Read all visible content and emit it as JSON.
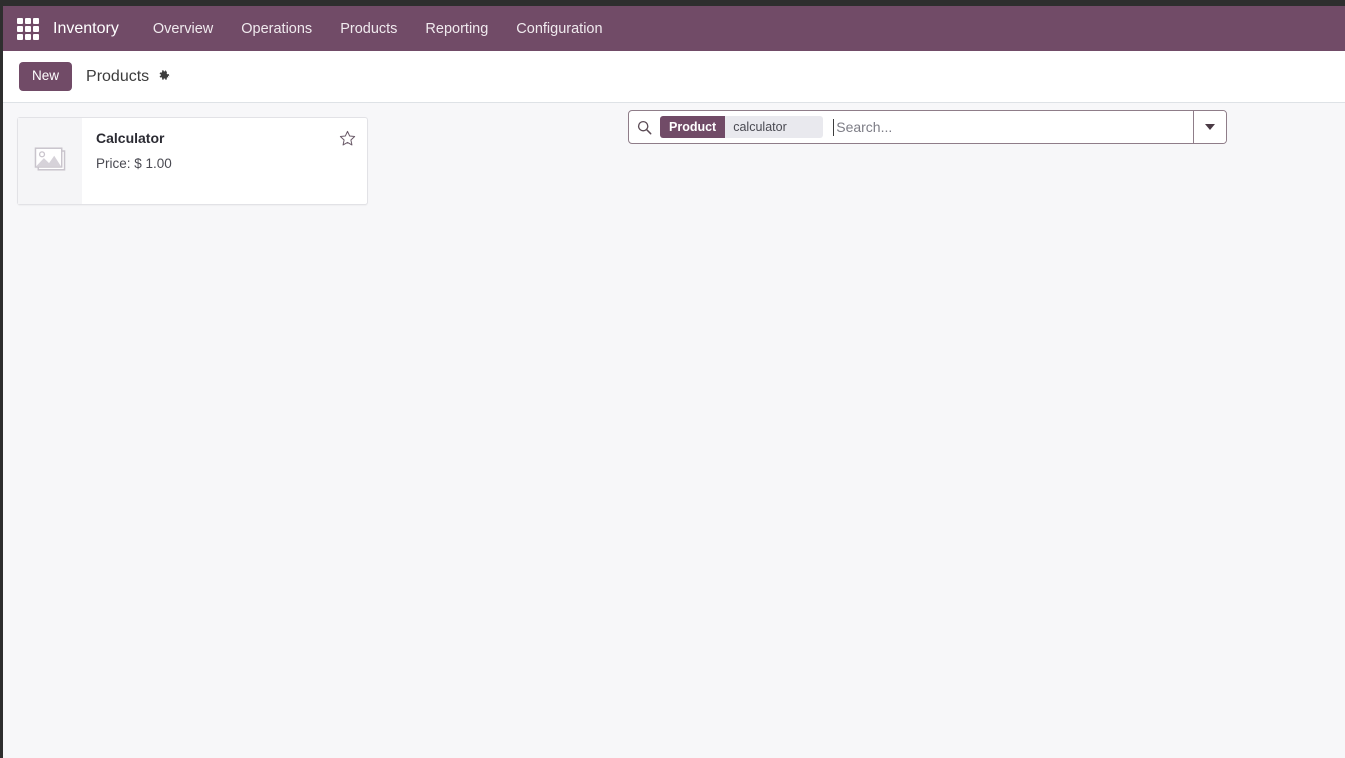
{
  "navbar": {
    "apps_icon": "apps-grid-icon",
    "brand": "Inventory",
    "menu": [
      {
        "label": "Overview"
      },
      {
        "label": "Operations"
      },
      {
        "label": "Products"
      },
      {
        "label": "Reporting"
      },
      {
        "label": "Configuration"
      }
    ],
    "background_color": "#714B67"
  },
  "control_panel": {
    "new_button": "New",
    "breadcrumb": "Products",
    "settings_icon": "gear-icon"
  },
  "search": {
    "search_icon": "magnifier-icon",
    "facet": {
      "field": "Product",
      "value": "calculator"
    },
    "placeholder": "Search...",
    "value": "",
    "toggle_icon": "chevron-down-icon"
  },
  "records": [
    {
      "title": "Calculator",
      "price_label": "Price: $ 1.00",
      "image_placeholder": "image-placeholder-icon",
      "favorite_icon": "star-outline-icon",
      "favorite": false
    }
  ],
  "colors": {
    "brand_purple": "#714B67",
    "content_background": "#f7f7f9",
    "panel_background": "#ffffff"
  }
}
